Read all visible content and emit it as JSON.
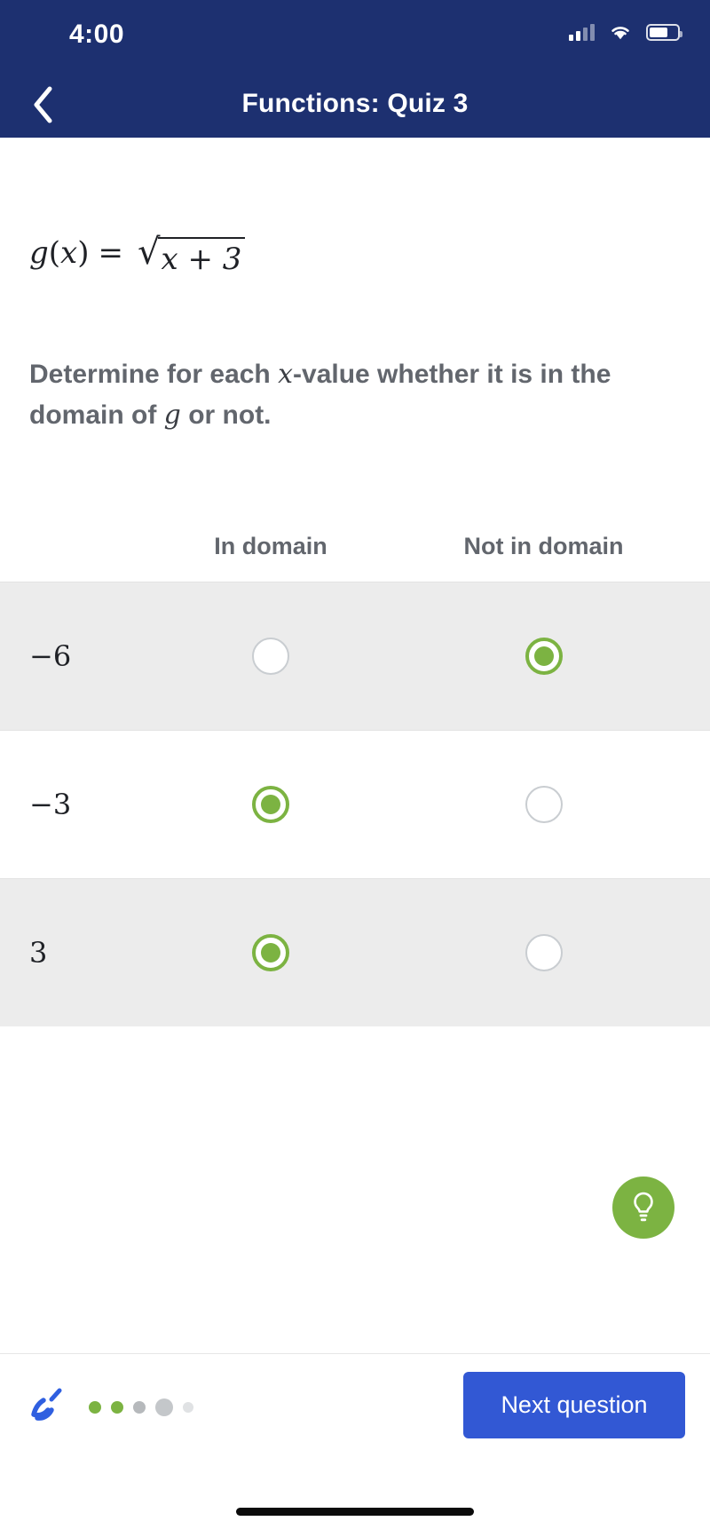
{
  "status_bar": {
    "time": "4:00",
    "signal_icon": "cellular-signal-icon",
    "wifi_icon": "wifi-icon",
    "battery_icon": "battery-icon"
  },
  "header": {
    "back_icon": "chevron-left-icon",
    "title": "Functions: Quiz 3",
    "background_color": "#1d3070"
  },
  "question": {
    "formula": {
      "function_name": "g",
      "variable": "x",
      "equals": "=",
      "radical_symbol": "√",
      "radicand": "x + 3",
      "plain_text": "g(x) = √(x + 3)"
    },
    "prompt_part1": "Determine for each ",
    "prompt_var1": "x",
    "prompt_part2": "-value whether it is in the domain of ",
    "prompt_var2": "g",
    "prompt_part3": " or not.",
    "prompt_plain": "Determine for each x-value whether it is in the domain of g or not."
  },
  "table": {
    "columns": [
      "In domain",
      "Not in domain"
    ],
    "rows": [
      {
        "value": "−6",
        "in_domain_selected": false,
        "not_in_domain_selected": true,
        "shaded": true
      },
      {
        "value": "−3",
        "in_domain_selected": true,
        "not_in_domain_selected": false,
        "shaded": false
      },
      {
        "value": "3",
        "in_domain_selected": true,
        "not_in_domain_selected": false,
        "shaded": true
      }
    ],
    "selected_color": "#7cb342",
    "unselected_border_color": "#c9cdd1",
    "shaded_row_color": "#ececec"
  },
  "hint": {
    "icon": "lightbulb-icon",
    "background_color": "#7cb342"
  },
  "footer": {
    "logo_icon": "khan-academy-logo-icon",
    "progress_dots": [
      {
        "state": "complete",
        "color": "#7cb342",
        "size": 14
      },
      {
        "state": "complete",
        "color": "#7cb342",
        "size": 14
      },
      {
        "state": "current",
        "color": "#b6b9bc",
        "size": 14
      },
      {
        "state": "upcoming",
        "color": "#c4c7ca",
        "size": 20
      },
      {
        "state": "upcoming",
        "color": "#e0e2e4",
        "size": 12
      }
    ],
    "next_button_label": "Next question",
    "next_button_color": "#3258d4"
  }
}
